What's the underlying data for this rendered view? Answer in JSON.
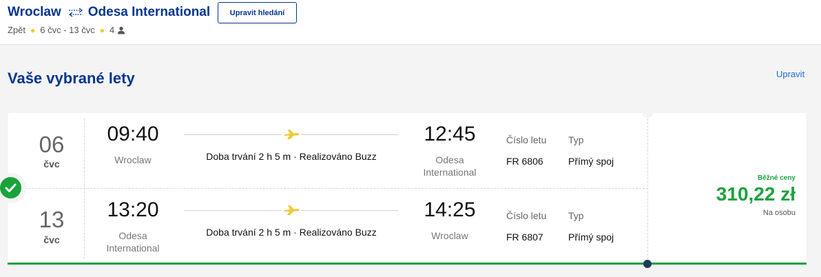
{
  "header": {
    "origin": "Wroclaw",
    "destination": "Odesa International",
    "route_icon": "two-way-arrows-icon",
    "edit_search_label": "Upravit hledání",
    "trip_type": "Zpět",
    "dates": "6 čvc - 13 čvc",
    "passengers": "4",
    "passenger_icon": "person-icon"
  },
  "section": {
    "title": "Vaše vybrané lety",
    "edit_label": "Upravit"
  },
  "flights": [
    {
      "day": "06",
      "month": "čvc",
      "depart_time": "09:40",
      "depart_city": "Wroclaw",
      "arrive_time": "12:45",
      "arrive_city": "Odesa International",
      "duration_text": "Doba trvání 2 h 5 m · Realizováno Buzz",
      "flight_no_label": "Číslo letu",
      "flight_no": "FR 6806",
      "type_label": "Typ",
      "type_value": "Přímý spoj"
    },
    {
      "day": "13",
      "month": "čvc",
      "depart_time": "13:20",
      "depart_city": "Odesa International",
      "arrive_time": "14:25",
      "arrive_city": "Wroclaw",
      "duration_text": "Doba trvání 2 h 5 m · Realizováno Buzz",
      "flight_no_label": "Číslo letu",
      "flight_no": "FR 6807",
      "type_label": "Typ",
      "type_value": "Přímý spoj"
    }
  ],
  "fare": {
    "type_label": "Běžné ceny",
    "price": "310,22 zł",
    "per_person": "Na osobu"
  },
  "colors": {
    "brand_blue": "#073590",
    "link_blue": "#1e6ad0",
    "accent_yellow": "#f1c933",
    "success_green": "#1aa33c"
  }
}
